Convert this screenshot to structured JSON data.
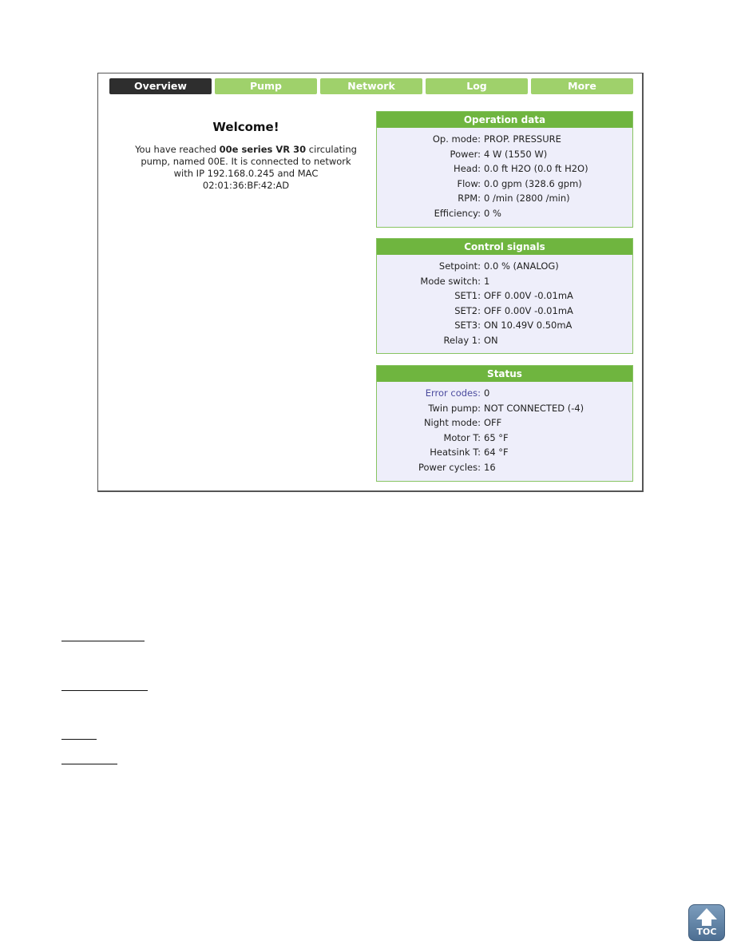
{
  "tabs": [
    {
      "label": "Overview",
      "active": true
    },
    {
      "label": "Pump",
      "active": false
    },
    {
      "label": "Network",
      "active": false
    },
    {
      "label": "Log",
      "active": false
    },
    {
      "label": "More",
      "active": false
    }
  ],
  "welcome": {
    "title": "Welcome!",
    "text_before": "You have reached ",
    "model": "00e series VR 30",
    "text_after": " circulating pump, named 00E. It is connected to network with IP 192.168.0.245 and MAC 02:01:36:BF:42:AD"
  },
  "operation_data": {
    "title": "Operation data",
    "rows": [
      {
        "label": "Op. mode:",
        "value": "PROP. PRESSURE"
      },
      {
        "label": "Power:",
        "value": "4 W (1550 W)"
      },
      {
        "label": "Head:",
        "value": "0.0 ft H2O (0.0 ft H2O)"
      },
      {
        "label": "Flow:",
        "value": "0.0 gpm (328.6 gpm)"
      },
      {
        "label": "RPM:",
        "value": "0 /min (2800 /min)"
      },
      {
        "label": "Efficiency:",
        "value": "0 %"
      }
    ]
  },
  "control_signals": {
    "title": "Control signals",
    "rows": [
      {
        "label": "Setpoint:",
        "value": "0.0 % (ANALOG)"
      },
      {
        "label": "Mode switch:",
        "value": "1"
      },
      {
        "label": "SET1:",
        "value": "OFF 0.00V -0.01mA"
      },
      {
        "label": "SET2:",
        "value": "OFF 0.00V -0.01mA"
      },
      {
        "label": "SET3:",
        "value": "ON 10.49V 0.50mA"
      },
      {
        "label": "Relay 1:",
        "value": "ON"
      }
    ]
  },
  "status": {
    "title": "Status",
    "rows": [
      {
        "label": "Error codes:",
        "value": "0"
      },
      {
        "label": "Twin pump:",
        "value": "NOT CONNECTED (-4)"
      },
      {
        "label": "Night mode:",
        "value": "OFF"
      },
      {
        "label": "Motor T:",
        "value": "65 °F"
      },
      {
        "label": "Heatsink T:",
        "value": "64 °F"
      },
      {
        "label": "Power cycles:",
        "value": "16"
      }
    ]
  },
  "toc_button": {
    "label": "TOC",
    "icon": "arrow-up-icon"
  }
}
